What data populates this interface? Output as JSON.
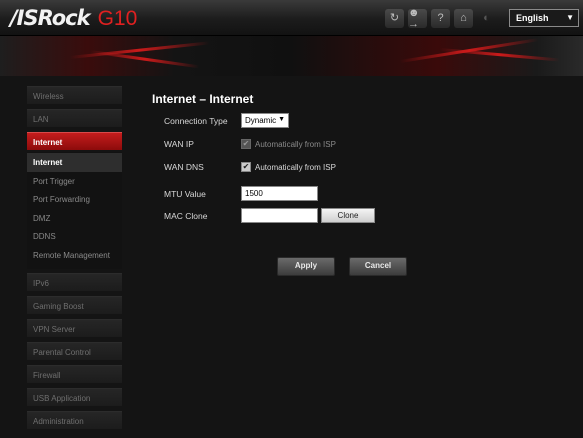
{
  "header": {
    "brand_name": "/ISRock",
    "model": "G10",
    "icons": [
      "refresh-icon",
      "user-transfer-icon",
      "help-icon",
      "home-icon",
      "settings-icon"
    ],
    "language": "English"
  },
  "sidebar": {
    "items": [
      {
        "label": "Wireless"
      },
      {
        "label": "LAN"
      },
      {
        "label": "Internet",
        "active": true
      },
      {
        "label": "IPv6"
      },
      {
        "label": "Gaming Boost"
      },
      {
        "label": "VPN Server"
      },
      {
        "label": "Parental Control"
      },
      {
        "label": "Firewall"
      },
      {
        "label": "USB Application"
      },
      {
        "label": "Administration"
      }
    ],
    "submenu": [
      {
        "label": "Internet",
        "active": true
      },
      {
        "label": "Port Trigger"
      },
      {
        "label": "Port Forwarding"
      },
      {
        "label": "DMZ"
      },
      {
        "label": "DDNS"
      },
      {
        "label": "Remote Management"
      }
    ]
  },
  "main": {
    "title": "Internet – Internet",
    "connection_type": {
      "label": "Connection Type",
      "value": "Dynamic"
    },
    "wan_ip": {
      "label": "WAN IP",
      "checkbox_label": "Automatically from ISP",
      "checked": true,
      "disabled": true
    },
    "wan_dns": {
      "label": "WAN DNS",
      "checkbox_label": "Automatically from ISP",
      "checked": true
    },
    "mtu": {
      "label": "MTU Value",
      "value": "1500"
    },
    "mac_clone": {
      "label": "MAC Clone",
      "value": "",
      "button_label": "Clone"
    },
    "apply_label": "Apply",
    "cancel_label": "Cancel"
  },
  "colors": {
    "accent": "#c41d1d",
    "background": "#141414"
  }
}
